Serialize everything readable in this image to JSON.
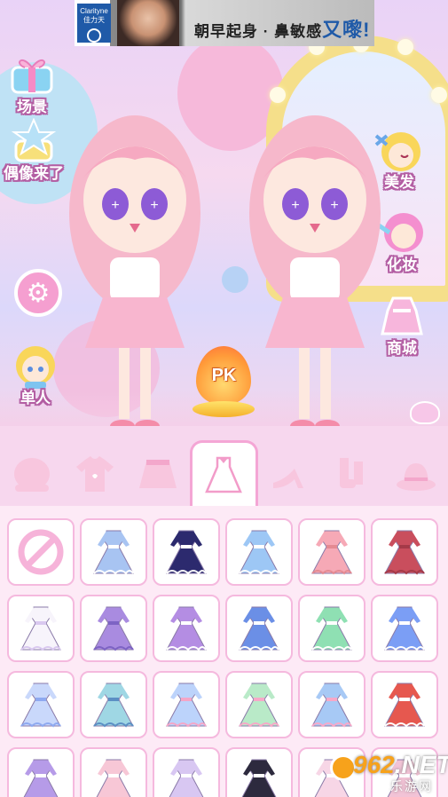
{
  "ad": {
    "brand": "Clarityne",
    "brand_sub": "佳力天",
    "headline_a": "朝早起身 · 鼻敏感",
    "headline_b": "又嚟!"
  },
  "left_menu": {
    "scene_label": "场景",
    "idol_label": "偶像来了",
    "single_label": "单人"
  },
  "right_menu": {
    "hair_label": "美发",
    "makeup_label": "化妆",
    "shop_label": "商城"
  },
  "pk_label": "PK",
  "categories": [
    {
      "name": "face",
      "icon": "face-icon"
    },
    {
      "name": "top",
      "icon": "tshirt-icon"
    },
    {
      "name": "skirt",
      "icon": "skirt-icon"
    },
    {
      "name": "dress",
      "icon": "dress-icon",
      "active": true
    },
    {
      "name": "shoes",
      "icon": "heels-icon"
    },
    {
      "name": "socks",
      "icon": "socks-icon"
    },
    {
      "name": "hat",
      "icon": "hat-icon"
    }
  ],
  "items": [
    {
      "icon": "none-icon"
    },
    {
      "icon": "dress-icon",
      "color": "#a8c4f2",
      "accent": "#ffffff"
    },
    {
      "icon": "dress-icon",
      "color": "#2c2a6e",
      "accent": "#ffffff"
    },
    {
      "icon": "dress-icon",
      "color": "#9dc7f5",
      "accent": "#ffffff"
    },
    {
      "icon": "dress-icon",
      "color": "#f6a9b6",
      "accent": "#e48a92"
    },
    {
      "icon": "dress-icon",
      "color": "#c94e5d",
      "accent": "#a43a48"
    },
    {
      "icon": "dress-icon",
      "color": "#f7f4fb",
      "accent": "#d9c8ef"
    },
    {
      "icon": "dress-icon",
      "color": "#a98be0",
      "accent": "#7d63c4"
    },
    {
      "icon": "dress-icon",
      "color": "#b48de3",
      "accent": "#ffffff"
    },
    {
      "icon": "dress-icon",
      "color": "#6b8fe6",
      "accent": "#ffffff"
    },
    {
      "icon": "dress-icon",
      "color": "#8fe0b3",
      "accent": "#ffffff"
    },
    {
      "icon": "dress-icon",
      "color": "#7b9ef5",
      "accent": "#ffffff"
    },
    {
      "icon": "dress-icon",
      "color": "#c9d8fb",
      "accent": "#8ea9f0"
    },
    {
      "icon": "dress-icon",
      "color": "#9fd7e4",
      "accent": "#5b8fc4"
    },
    {
      "icon": "dress-icon",
      "color": "#bcd3fb",
      "accent": "#f4a6c7"
    },
    {
      "icon": "dress-icon",
      "color": "#b9eac8",
      "accent": "#f7a8c8"
    },
    {
      "icon": "dress-icon",
      "color": "#a7c9f5",
      "accent": "#f7a8c8"
    },
    {
      "icon": "dress-icon",
      "color": "#e6584f",
      "accent": "#ffffff"
    },
    {
      "icon": "dress-icon",
      "color": "#b69be8",
      "accent": "#ffffff"
    },
    {
      "icon": "dress-icon",
      "color": "#f7c7d6",
      "accent": "#ffffff"
    },
    {
      "icon": "dress-icon",
      "color": "#d8c7f2",
      "accent": "#ffffff"
    },
    {
      "icon": "dress-icon",
      "color": "#2d2a3e",
      "accent": "#ffffff"
    },
    {
      "icon": "dress-icon",
      "color": "#f7d6e6",
      "accent": "#ffffff"
    },
    {
      "icon": "dress-icon",
      "color": "#f2c3d6",
      "accent": "#ffffff"
    }
  ],
  "watermark": {
    "number_a": "962",
    "number_b": ".NET",
    "site": "乐游网"
  }
}
